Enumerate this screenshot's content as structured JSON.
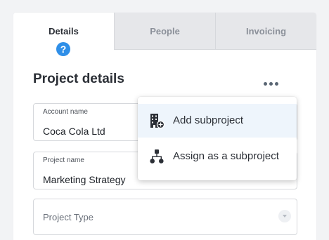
{
  "tabs": [
    {
      "label": "Details",
      "active": true
    },
    {
      "label": "People",
      "active": false
    },
    {
      "label": "Invoicing",
      "active": false
    }
  ],
  "help_icon": "?",
  "section": {
    "title": "Project details"
  },
  "fields": {
    "account": {
      "label": "Account name",
      "value": "Coca Cola Ltd"
    },
    "project": {
      "label": "Project name",
      "value": "Marketing Strategy"
    },
    "type": {
      "placeholder": "Project Type"
    }
  },
  "menu": {
    "items": [
      {
        "label": "Add subproject",
        "icon": "building-plus-icon",
        "highlighted": true
      },
      {
        "label": "Assign as a subproject",
        "icon": "hierarchy-icon",
        "highlighted": false
      }
    ]
  },
  "colors": {
    "accent": "#2f8fe8",
    "highlight": "#eef5fc",
    "icon": "#2b2f36"
  }
}
